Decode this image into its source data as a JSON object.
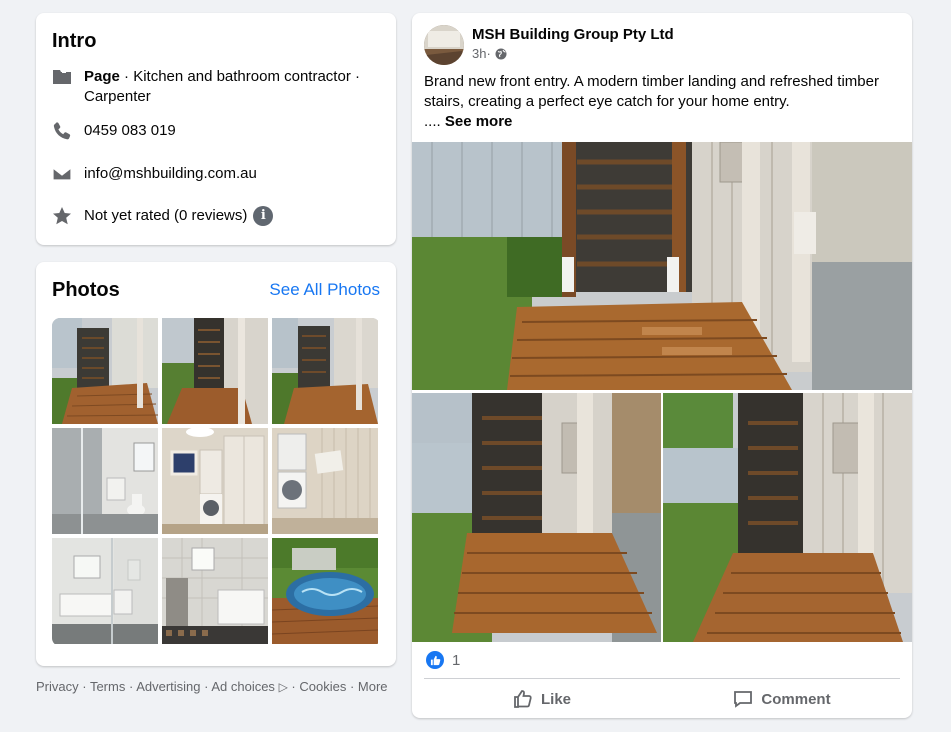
{
  "intro": {
    "title": "Intro",
    "page_label": "Page",
    "page_category": " · Kitchen and bathroom contractor · Carpenter",
    "phone": "0459 083 019",
    "email": "info@mshbuilding.com.au",
    "rating": "Not yet rated (0 reviews)",
    "info_glyph": "i",
    "icons": [
      "flag-icon",
      "phone-icon",
      "mail-icon",
      "star-icon",
      "info-icon"
    ]
  },
  "photos": {
    "title": "Photos",
    "see_all": "See All Photos",
    "thumbnails": [
      "stairs-deck-1",
      "stairs-deck-2",
      "stairs-deck-3",
      "bathroom-shower",
      "laundry-cabinets",
      "laundry-wall",
      "bathroom-window",
      "bathroom-bathtub",
      "pool-deck"
    ]
  },
  "footer": {
    "links": [
      "Privacy",
      "Terms",
      "Advertising",
      "Ad choices",
      "Cookies",
      "More"
    ],
    "separator": " · ",
    "adchoice_glyph": "▷"
  },
  "post": {
    "page_name": "MSH Building Group Pty Ltd",
    "time": "3h",
    "time_sep": " · ",
    "text": "Brand new front entry. A modern timber landing and refreshed timber stairs, creating a perfect eye catch for your home entry.",
    "ellipsis": ".... ",
    "see_more": "See more",
    "reaction_count": "1",
    "like_label": "Like",
    "comment_label": "Comment"
  },
  "colors": {
    "accent": "#1877f2",
    "page_bg": "#f0f2f5",
    "secondary_text": "#65676b",
    "timber": "#a86a3a",
    "lawn": "#5f7f34"
  }
}
